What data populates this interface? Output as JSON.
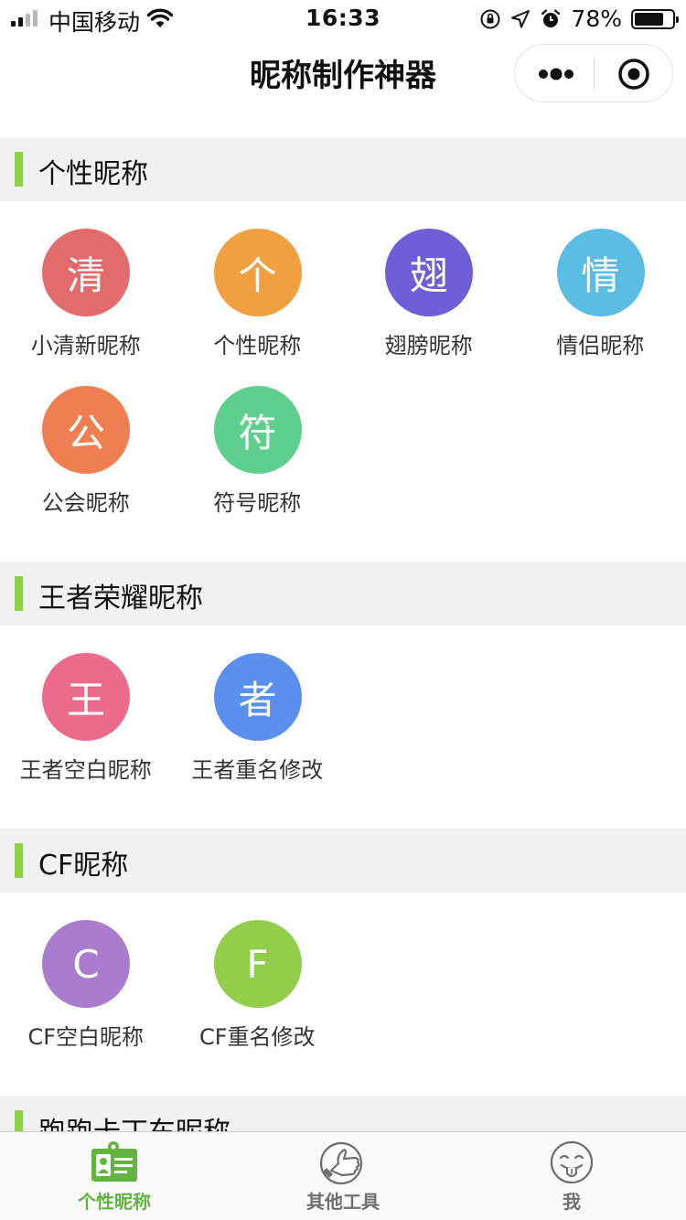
{
  "status_bar": {
    "carrier": "中国移动",
    "time": "16:33",
    "battery_percent_text": "78%",
    "battery_level": 0.78
  },
  "nav": {
    "title": "昵称制作神器"
  },
  "sections": [
    {
      "title": "个性昵称",
      "items": [
        {
          "char": "清",
          "label": "小清新昵称",
          "color": "#e26b6b"
        },
        {
          "char": "个",
          "label": "个性昵称",
          "color": "#f0a040"
        },
        {
          "char": "翅",
          "label": "翅膀昵称",
          "color": "#6f5fd6"
        },
        {
          "char": "情",
          "label": "情侣昵称",
          "color": "#5bbde4"
        },
        {
          "char": "公",
          "label": "公会昵称",
          "color": "#ef7f52"
        },
        {
          "char": "符",
          "label": "符号昵称",
          "color": "#5ecf8f"
        }
      ]
    },
    {
      "title": "王者荣耀昵称",
      "items": [
        {
          "char": "王",
          "label": "王者空白昵称",
          "color": "#ea6b8a"
        },
        {
          "char": "者",
          "label": "王者重名修改",
          "color": "#5b8fee"
        }
      ]
    },
    {
      "title": "CF昵称",
      "items": [
        {
          "char": "C",
          "label": "CF空白昵称",
          "color": "#a97ccd"
        },
        {
          "char": "F",
          "label": "CF重名修改",
          "color": "#92cd4b"
        }
      ]
    },
    {
      "title": "跑跑卡丁车昵称",
      "items": []
    }
  ],
  "tabs": [
    {
      "label": "个性昵称",
      "icon": "id-card-icon",
      "active": true
    },
    {
      "label": "其他工具",
      "icon": "thumbs-up-icon",
      "active": false
    },
    {
      "label": "我",
      "icon": "tongue-face-icon",
      "active": false
    }
  ],
  "colors": {
    "accent": "#8dd04a",
    "tab_active": "#62b33f",
    "section_bg": "#f1f1f1"
  }
}
